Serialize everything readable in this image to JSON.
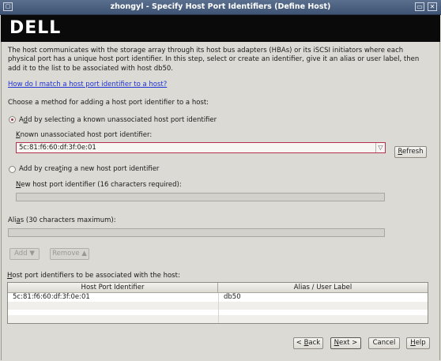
{
  "window": {
    "title": "zhongyl - Specify Host Port Identifiers (Define Host)",
    "logo": "DELL"
  },
  "intro": {
    "description": "The host communicates with the storage array through its host bus adapters (HBAs) or its iSCSI initiators where each physical port has a unique host port identifier. In this step, select or create an identifier, give it an alias or user label, then add it to the list to be associated with host db50.",
    "help_link": "How do I match a host port identifier to a host?"
  },
  "method": {
    "prompt": "Choose a method for adding a host port identifier to a host:",
    "option_known": {
      "prefix": "A",
      "mnemonic": "d",
      "suffix": "d by selecting a known unassociated host port identifier",
      "selected": true
    },
    "known_label": {
      "mnemonic": "K",
      "suffix": "nown unassociated host port identifier:"
    },
    "known_value": "5c:81:f6:60:df:3f:0e:01",
    "refresh": {
      "mnemonic": "R",
      "suffix": "efresh"
    },
    "option_new": {
      "prefix": "Add by crea",
      "mnemonic": "t",
      "suffix": "ing a new host port identifier",
      "selected": false
    },
    "new_label": {
      "mnemonic": "N",
      "suffix": "ew host port identifier (16 characters required):"
    },
    "new_value": ""
  },
  "alias": {
    "label": {
      "prefix": "Ali",
      "mnemonic": "a",
      "suffix": "s (30 characters maximum):"
    },
    "value": ""
  },
  "actions": {
    "add": "Add",
    "remove": "Remove"
  },
  "associated": {
    "label": {
      "prefix": "",
      "mnemonic": "H",
      "suffix": "ost port identifiers to be associated with the host:"
    },
    "columns": [
      "Host Port Identifier",
      "Alias / User Label"
    ],
    "rows": [
      [
        "5c:81:f6:60:df:3f:0e:01",
        "db50"
      ]
    ]
  },
  "footer": {
    "back": {
      "prefix": "< ",
      "mnemonic": "B",
      "suffix": "ack"
    },
    "next": {
      "mnemonic": "N",
      "suffix": "ext >"
    },
    "cancel": "Cancel",
    "help": {
      "mnemonic": "H",
      "suffix": "elp"
    }
  },
  "icons": {
    "window_icon": "window-menu-icon",
    "minimize": "minimize-icon",
    "close": "close-icon",
    "dropdown": "chevron-down-icon",
    "add_arrow": "arrow-down-icon",
    "remove_arrow": "arrow-up-icon"
  }
}
